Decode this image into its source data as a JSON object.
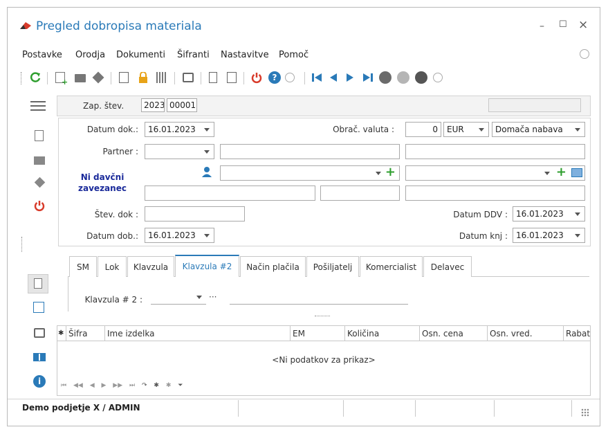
{
  "window": {
    "title": "Pregled dobropisa materiala",
    "minimize": "–",
    "maximize": "☐",
    "close": "×"
  },
  "menu": [
    "Postavke",
    "Orodja",
    "Dokumenti",
    "Šifranti",
    "Nastavitve",
    "Pomoč"
  ],
  "header": {
    "zap_label": "Zap. štev.",
    "year": "2023",
    "number": "00001"
  },
  "form": {
    "datum_dok_label": "Datum dok.:",
    "datum_dok": "16.01.2023",
    "partner_label": "Partner :",
    "davcni_line1": "Ni davčni",
    "davcni_line2": "zavezanec",
    "stev_dok_label": "Štev. dok :",
    "datum_dob_label": "Datum dob.:",
    "datum_dob": "16.01.2023",
    "valuta_label": "Obrač. valuta :",
    "valuta_amount": "0",
    "valuta_code": "EUR",
    "nabava": "Domača nabava",
    "datum_ddv_label": "Datum DDV :",
    "datum_ddv": "16.01.2023",
    "datum_knj_label": "Datum knj :",
    "datum_knj": "16.01.2023"
  },
  "tabs": [
    "SM",
    "Lok",
    "Klavzula",
    "Klavzula #2",
    "Način plačila",
    "Pošiljatelj",
    "Komercialist",
    "Delavec"
  ],
  "active_tab": "Klavzula #2",
  "tab_content": {
    "klavzula2_label": "Klavzula # 2 :",
    "ellipsis": "···"
  },
  "grid": {
    "columns": [
      "Šifra",
      "Ime izdelka",
      "EM",
      "Količina",
      "Osn. cena",
      "Osn. vred.",
      "Rabat"
    ],
    "empty_text": "<Ni podatkov za prikaz>",
    "nav_symbols": [
      "⏮",
      "◀◀",
      "◀",
      "▶",
      "▶▶",
      "⏭",
      "↷",
      "✱",
      "✱",
      "⏷"
    ]
  },
  "status": {
    "company": "Demo podjetje X / ADMIN"
  },
  "colors": {
    "accent": "#2a7ab8",
    "green": "#2e9e2e",
    "red": "#d83b2b"
  }
}
